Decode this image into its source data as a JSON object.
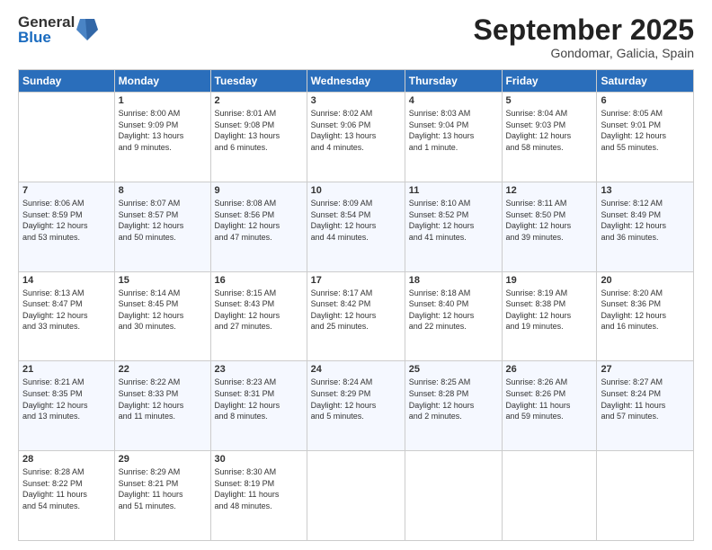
{
  "logo": {
    "general": "General",
    "blue": "Blue"
  },
  "title": "September 2025",
  "location": "Gondomar, Galicia, Spain",
  "days_of_week": [
    "Sunday",
    "Monday",
    "Tuesday",
    "Wednesday",
    "Thursday",
    "Friday",
    "Saturday"
  ],
  "weeks": [
    [
      {
        "day": "",
        "content": ""
      },
      {
        "day": "1",
        "content": "Sunrise: 8:00 AM\nSunset: 9:09 PM\nDaylight: 13 hours\nand 9 minutes."
      },
      {
        "day": "2",
        "content": "Sunrise: 8:01 AM\nSunset: 9:08 PM\nDaylight: 13 hours\nand 6 minutes."
      },
      {
        "day": "3",
        "content": "Sunrise: 8:02 AM\nSunset: 9:06 PM\nDaylight: 13 hours\nand 4 minutes."
      },
      {
        "day": "4",
        "content": "Sunrise: 8:03 AM\nSunset: 9:04 PM\nDaylight: 13 hours\nand 1 minute."
      },
      {
        "day": "5",
        "content": "Sunrise: 8:04 AM\nSunset: 9:03 PM\nDaylight: 12 hours\nand 58 minutes."
      },
      {
        "day": "6",
        "content": "Sunrise: 8:05 AM\nSunset: 9:01 PM\nDaylight: 12 hours\nand 55 minutes."
      }
    ],
    [
      {
        "day": "7",
        "content": "Sunrise: 8:06 AM\nSunset: 8:59 PM\nDaylight: 12 hours\nand 53 minutes."
      },
      {
        "day": "8",
        "content": "Sunrise: 8:07 AM\nSunset: 8:57 PM\nDaylight: 12 hours\nand 50 minutes."
      },
      {
        "day": "9",
        "content": "Sunrise: 8:08 AM\nSunset: 8:56 PM\nDaylight: 12 hours\nand 47 minutes."
      },
      {
        "day": "10",
        "content": "Sunrise: 8:09 AM\nSunset: 8:54 PM\nDaylight: 12 hours\nand 44 minutes."
      },
      {
        "day": "11",
        "content": "Sunrise: 8:10 AM\nSunset: 8:52 PM\nDaylight: 12 hours\nand 41 minutes."
      },
      {
        "day": "12",
        "content": "Sunrise: 8:11 AM\nSunset: 8:50 PM\nDaylight: 12 hours\nand 39 minutes."
      },
      {
        "day": "13",
        "content": "Sunrise: 8:12 AM\nSunset: 8:49 PM\nDaylight: 12 hours\nand 36 minutes."
      }
    ],
    [
      {
        "day": "14",
        "content": "Sunrise: 8:13 AM\nSunset: 8:47 PM\nDaylight: 12 hours\nand 33 minutes."
      },
      {
        "day": "15",
        "content": "Sunrise: 8:14 AM\nSunset: 8:45 PM\nDaylight: 12 hours\nand 30 minutes."
      },
      {
        "day": "16",
        "content": "Sunrise: 8:15 AM\nSunset: 8:43 PM\nDaylight: 12 hours\nand 27 minutes."
      },
      {
        "day": "17",
        "content": "Sunrise: 8:17 AM\nSunset: 8:42 PM\nDaylight: 12 hours\nand 25 minutes."
      },
      {
        "day": "18",
        "content": "Sunrise: 8:18 AM\nSunset: 8:40 PM\nDaylight: 12 hours\nand 22 minutes."
      },
      {
        "day": "19",
        "content": "Sunrise: 8:19 AM\nSunset: 8:38 PM\nDaylight: 12 hours\nand 19 minutes."
      },
      {
        "day": "20",
        "content": "Sunrise: 8:20 AM\nSunset: 8:36 PM\nDaylight: 12 hours\nand 16 minutes."
      }
    ],
    [
      {
        "day": "21",
        "content": "Sunrise: 8:21 AM\nSunset: 8:35 PM\nDaylight: 12 hours\nand 13 minutes."
      },
      {
        "day": "22",
        "content": "Sunrise: 8:22 AM\nSunset: 8:33 PM\nDaylight: 12 hours\nand 11 minutes."
      },
      {
        "day": "23",
        "content": "Sunrise: 8:23 AM\nSunset: 8:31 PM\nDaylight: 12 hours\nand 8 minutes."
      },
      {
        "day": "24",
        "content": "Sunrise: 8:24 AM\nSunset: 8:29 PM\nDaylight: 12 hours\nand 5 minutes."
      },
      {
        "day": "25",
        "content": "Sunrise: 8:25 AM\nSunset: 8:28 PM\nDaylight: 12 hours\nand 2 minutes."
      },
      {
        "day": "26",
        "content": "Sunrise: 8:26 AM\nSunset: 8:26 PM\nDaylight: 11 hours\nand 59 minutes."
      },
      {
        "day": "27",
        "content": "Sunrise: 8:27 AM\nSunset: 8:24 PM\nDaylight: 11 hours\nand 57 minutes."
      }
    ],
    [
      {
        "day": "28",
        "content": "Sunrise: 8:28 AM\nSunset: 8:22 PM\nDaylight: 11 hours\nand 54 minutes."
      },
      {
        "day": "29",
        "content": "Sunrise: 8:29 AM\nSunset: 8:21 PM\nDaylight: 11 hours\nand 51 minutes."
      },
      {
        "day": "30",
        "content": "Sunrise: 8:30 AM\nSunset: 8:19 PM\nDaylight: 11 hours\nand 48 minutes."
      },
      {
        "day": "",
        "content": ""
      },
      {
        "day": "",
        "content": ""
      },
      {
        "day": "",
        "content": ""
      },
      {
        "day": "",
        "content": ""
      }
    ]
  ]
}
